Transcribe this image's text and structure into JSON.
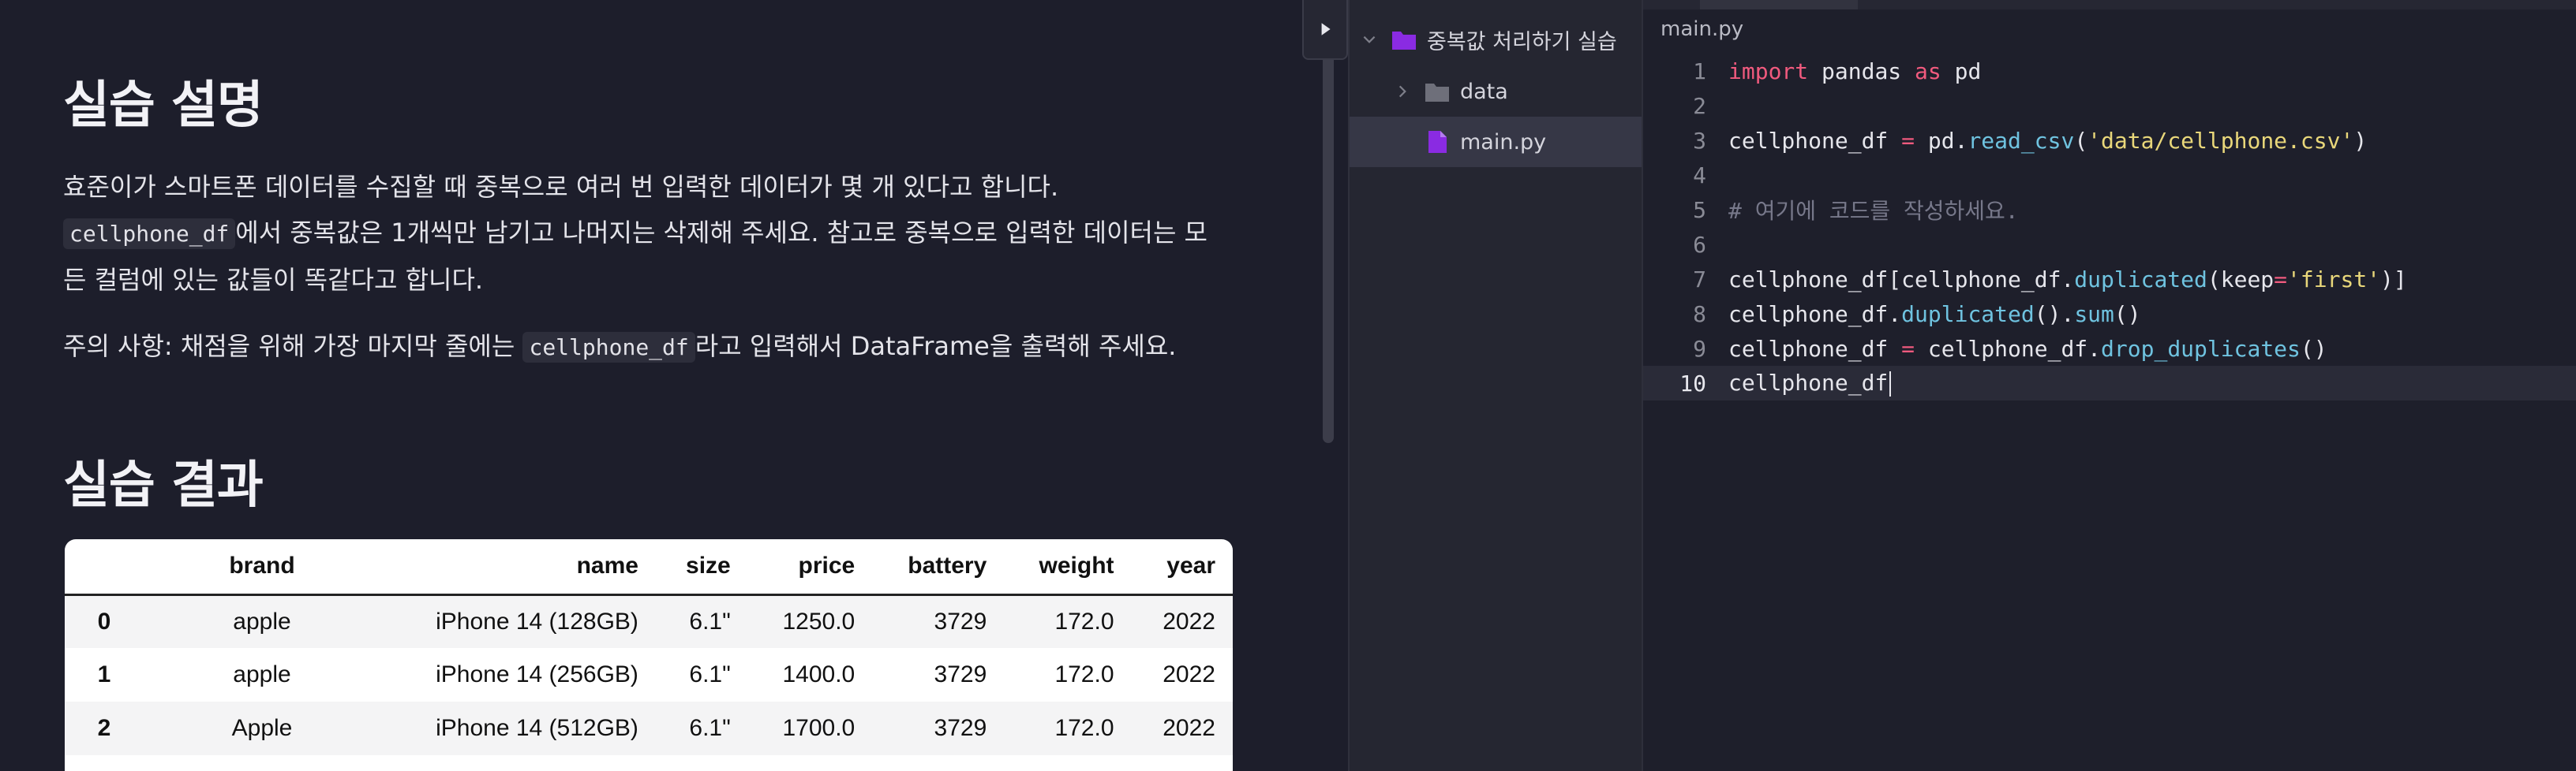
{
  "lesson": {
    "section1_title": "실습 설명",
    "para1_line1": "효준이가 스마트폰 데이터를 수집할 때 중복으로 여러 번 입력한 데이터가 몇 개 있다고 합니다.",
    "para1_code": "cellphone_df",
    "para1_line2_rest": "에서 중복값은 1개씩만 남기고 나머지는 삭제해 주세요. 참고로 중복으로 입력한 데이터는 모",
    "para1_line3": "든 컬럼에 있는 값들이 똑같다고 합니다.",
    "note_prefix": "주의 사항: 채점을 위해 가장 마지막 줄에는",
    "note_code": "cellphone_df",
    "note_suffix": "라고 입력해서 DataFrame을 출력해 주세요.",
    "section2_title": "실습 결과",
    "table": {
      "headers": [
        "",
        "brand",
        "name",
        "size",
        "price",
        "battery",
        "weight",
        "year"
      ],
      "rows": [
        [
          "0",
          "apple",
          "iPhone 14 (128GB)",
          "6.1\"",
          "1250.0",
          "3729",
          "172.0",
          "2022"
        ],
        [
          "1",
          "apple",
          "iPhone 14 (256GB)",
          "6.1\"",
          "1400.0",
          "3729",
          "172.0",
          "2022"
        ],
        [
          "2",
          "Apple",
          "iPhone 14 (512GB)",
          "6.1\"",
          "1700.0",
          "3729",
          "172.0",
          "2022"
        ]
      ]
    }
  },
  "explorer": {
    "root_folder": "중복값 처리하기 실습",
    "items": [
      {
        "label": "data",
        "type": "folder"
      },
      {
        "label": "main.py",
        "type": "file"
      }
    ]
  },
  "editor": {
    "file_title": "main.py",
    "line_numbers": [
      "1",
      "2",
      "3",
      "4",
      "5",
      "6",
      "7",
      "8",
      "9",
      "10"
    ]
  },
  "colors": {
    "accent_purple": "#8a2be2",
    "keyword": "#f05a7e",
    "function": "#6fc3e0",
    "string": "#e9d77a",
    "comment": "#77788a"
  }
}
